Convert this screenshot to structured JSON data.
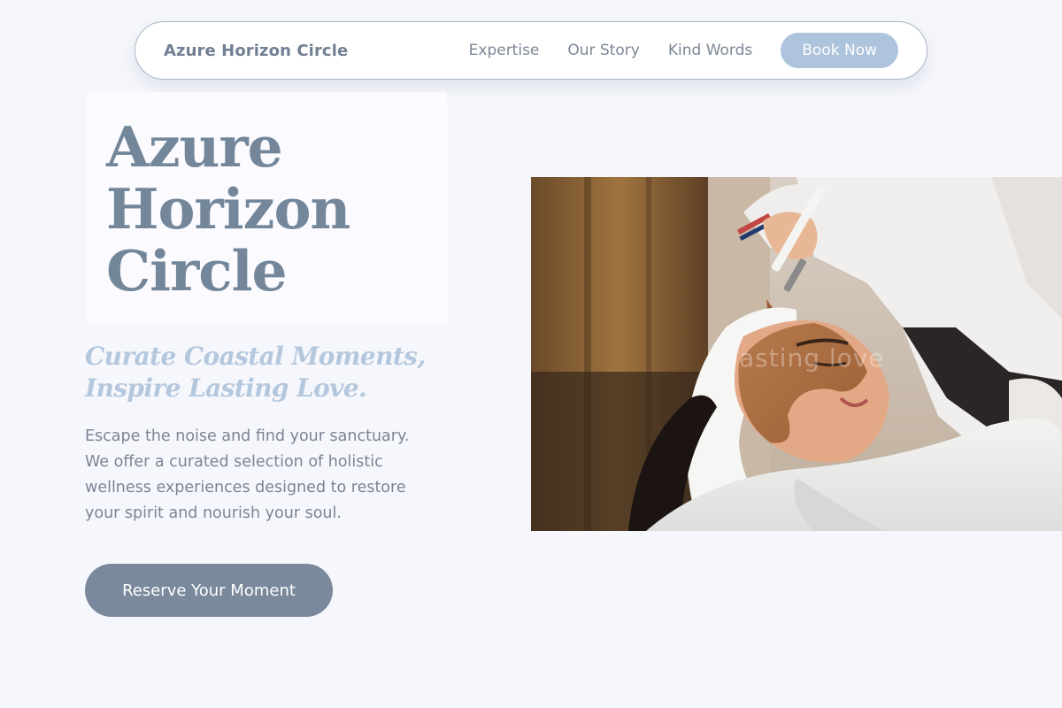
{
  "nav": {
    "brand": "Azure Horizon Circle",
    "links": [
      {
        "label": "Expertise"
      },
      {
        "label": "Our Story"
      },
      {
        "label": "Kind Words"
      }
    ],
    "book_label": "Book Now"
  },
  "hero": {
    "title_lines": [
      "Azure",
      "Horizon",
      "Circle"
    ],
    "tagline_lines": [
      "Curate Coastal Moments,",
      "Inspire Lasting Love."
    ],
    "intro_lines": [
      "Escape the noise and find your sanctuary.",
      "We offer a curated selection of holistic",
      "wellness experiences designed to restore",
      "your spirit and nourish your soul."
    ],
    "cta_label": "Reserve Your Moment"
  },
  "photo": {
    "watermark": "coasting love"
  },
  "colors": {
    "background": "#f6f7fc",
    "accent": "#aec3dc",
    "slate": "#7a899c"
  }
}
